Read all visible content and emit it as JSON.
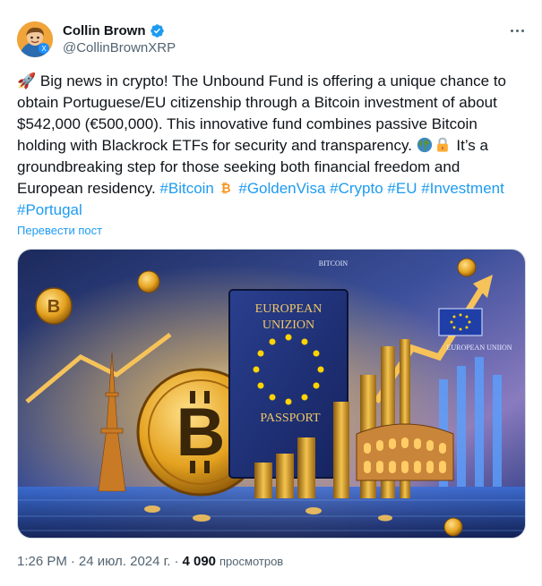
{
  "author": {
    "display_name": "Collin Brown",
    "handle": "@CollinBrownXRP",
    "verified": true
  },
  "post": {
    "rocket_emoji": "🚀",
    "segments": [
      {
        "type": "text",
        "value": "Big news in crypto! The Unbound Fund is offering a unique chance to obtain Portuguese/EU citizenship through a Bitcoin investment of about $542,000 (€500,000). This innovative fund combines passive Bitcoin holding with Blackrock ETFs for security and transparency. "
      },
      {
        "type": "text",
        "value": " It’s a groundbreaking step for those seeking both financial freedom and European residency. "
      }
    ],
    "hashtags": [
      "#Bitcoin",
      "#GoldenVisa",
      "#Crypto",
      "#EU",
      "#Investment",
      "#Portugal"
    ],
    "translate_label": "Перевести пост"
  },
  "media": {
    "image_text": {
      "bitcoin_top": "BITCOIN",
      "passport_title_1": "EUROPEAN",
      "passport_title_2": "UNIZION",
      "passport_label": "PASSPORT",
      "flag_caption": "EUROPEAN UNIION"
    }
  },
  "meta": {
    "time": "1:26 PM",
    "separator": "·",
    "date": "24 июл. 2024 г.",
    "views_count": "4 090",
    "views_label": "просмотров"
  },
  "colors": {
    "link": "#1d9bf0",
    "verified": "#1d9bf0",
    "secondary": "#536471"
  }
}
